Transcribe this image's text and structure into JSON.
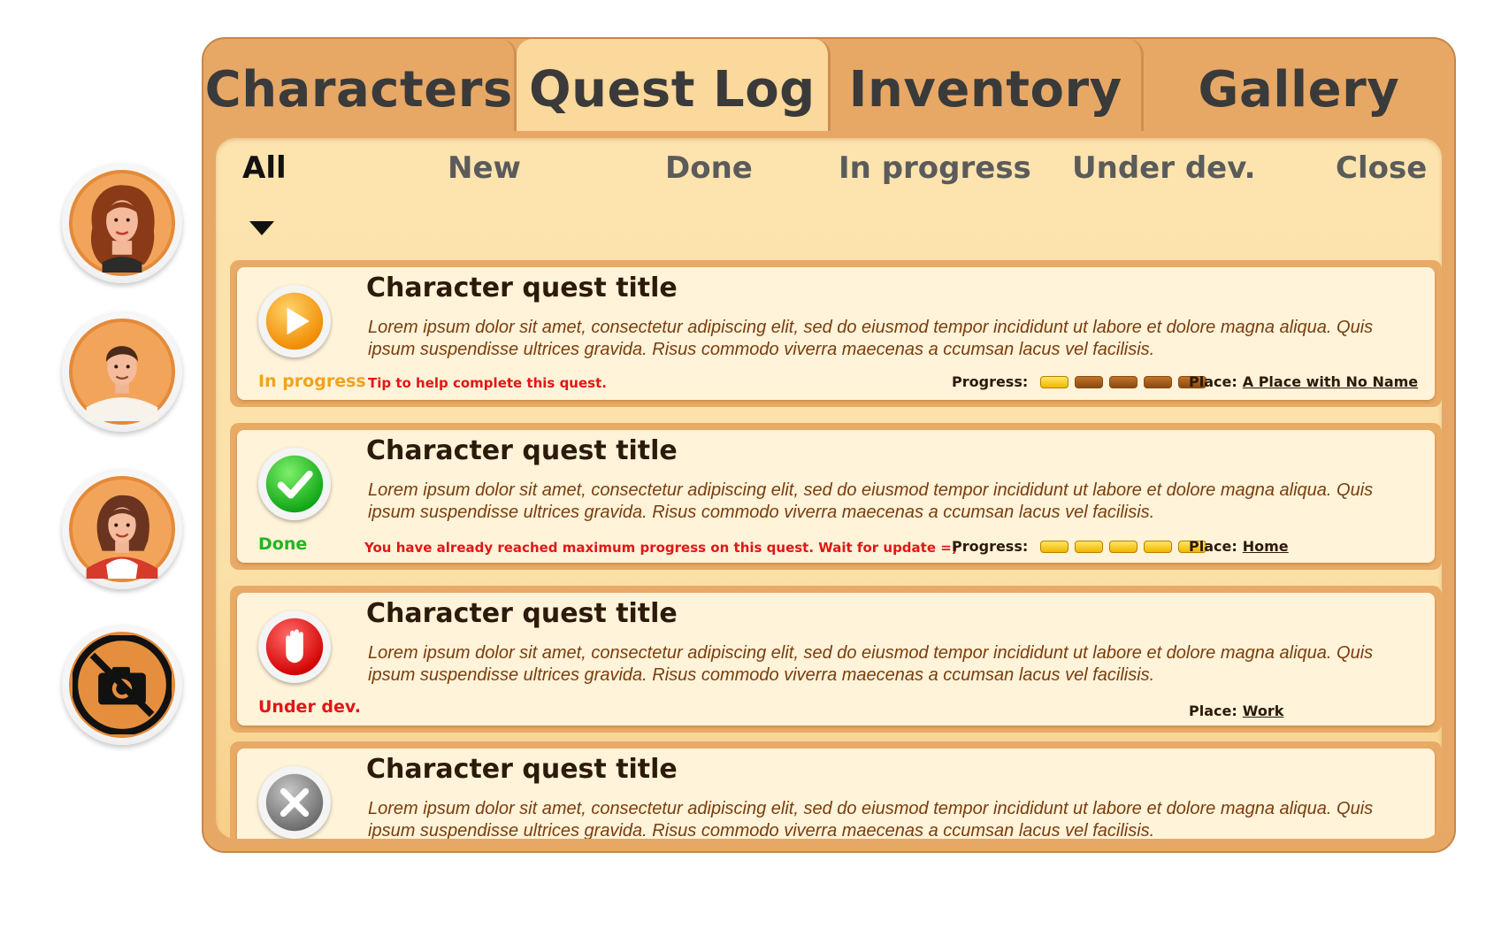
{
  "tabs": [
    {
      "label": "Characters",
      "active": false
    },
    {
      "label": "Quest Log",
      "active": true
    },
    {
      "label": "Inventory",
      "active": false
    },
    {
      "label": "Gallery",
      "active": false
    }
  ],
  "filters": {
    "all": "All",
    "new": "New",
    "done": "Done",
    "in_progress": "In progress",
    "under_dev": "Under dev.",
    "close": "Close",
    "selected": "All"
  },
  "avatars": [
    {
      "name": "red-haired woman",
      "icon": "avatar-woman-red-hair"
    },
    {
      "name": "man in white shirt",
      "icon": "avatar-man"
    },
    {
      "name": "woman in red",
      "icon": "avatar-woman-red-top"
    },
    {
      "name": "locked character",
      "icon": "no-camera-icon"
    }
  ],
  "progress_label": "Progress:",
  "place_label": "Place:",
  "quests": [
    {
      "title": "Character quest title",
      "description": "Lorem ipsum dolor sit amet, consectetur adipiscing elit, sed do eiusmod tempor incididunt ut labore et dolore magna aliqua. Quis ipsum suspendisse ultrices gravida. Risus commodo viverra maecenas a ccumsan lacus vel facilisis.",
      "status": "In progress",
      "status_color": "#f2a21e",
      "icon": "play-icon",
      "tip": "Tip to help complete this quest.",
      "progress": 1,
      "progress_max": 5,
      "place": "A Place with No Name"
    },
    {
      "title": "Character quest title",
      "description": "Lorem ipsum dolor sit amet, consectetur adipiscing elit, sed do eiusmod tempor incididunt ut labore et dolore magna aliqua. Quis ipsum suspendisse ultrices gravida. Risus commodo viverra maecenas a ccumsan lacus vel facilisis.",
      "status": "Done",
      "status_color": "#22b51f",
      "icon": "checkmark-icon",
      "tip": "You have already reached maximum progress on this quest. Wait for update =)",
      "progress": 5,
      "progress_max": 5,
      "place": "Home"
    },
    {
      "title": "Character quest title",
      "description": "Lorem ipsum dolor sit amet, consectetur adipiscing elit, sed do eiusmod tempor incididunt ut labore et dolore magna aliqua. Quis ipsum suspendisse ultrices gravida. Risus commodo viverra maecenas a ccumsan lacus vel facilisis.",
      "status": "Under dev.",
      "status_color": "#e01717",
      "icon": "stop-hand-icon",
      "place": "Work"
    },
    {
      "title": "Character quest title",
      "description": "Lorem ipsum dolor sit amet, consectetur adipiscing elit, sed do eiusmod tempor incididunt ut labore et dolore magna aliqua. Quis ipsum suspendisse ultrices gravida. Risus commodo viverra maecenas a ccumsan lacus vel facilisis.",
      "icon": "close-x-icon"
    }
  ],
  "colors": {
    "frame": "#e7a866",
    "panel": "#fbe1a9",
    "card": "#fff3d9",
    "tab_active": "#fbd89b"
  }
}
